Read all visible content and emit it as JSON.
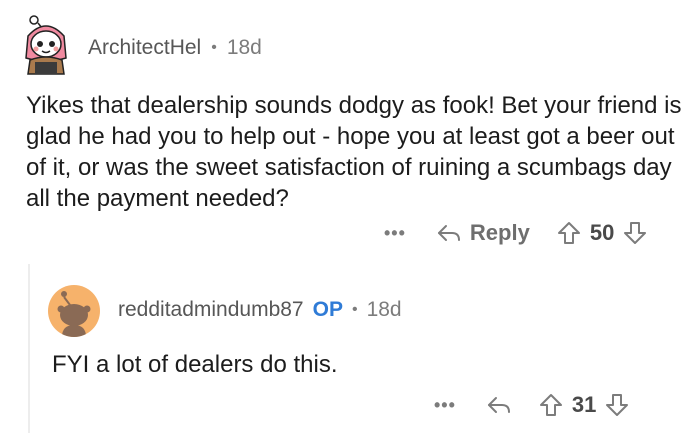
{
  "comments": [
    {
      "username": "ArchitectHel",
      "separator": "•",
      "age": "18d",
      "body": "Yikes that dealership sounds dodgy as fook! Bet your friend is glad he had you to help out - hope you at least got a beer out of it, or was the sweet satisfaction of ruining a scumbags day all the payment needed?",
      "more_label": "•••",
      "reply_label": "Reply",
      "score": "50"
    },
    {
      "username": "redditadmindumb87",
      "op_badge": "OP",
      "separator": "•",
      "age": "18d",
      "body": "FYI a lot of dealers do this.",
      "more_label": "•••",
      "score": "31"
    }
  ],
  "colors": {
    "username": "#575757",
    "meta": "#7c7c7c",
    "op_badge": "#2f7bd6",
    "avatar2_bg": "#f6b26b",
    "thread_line": "#ededed"
  },
  "icons": [
    "reply-icon",
    "upvote-icon",
    "downvote-icon",
    "more-options-icon",
    "snoo-avatar-icon"
  ]
}
